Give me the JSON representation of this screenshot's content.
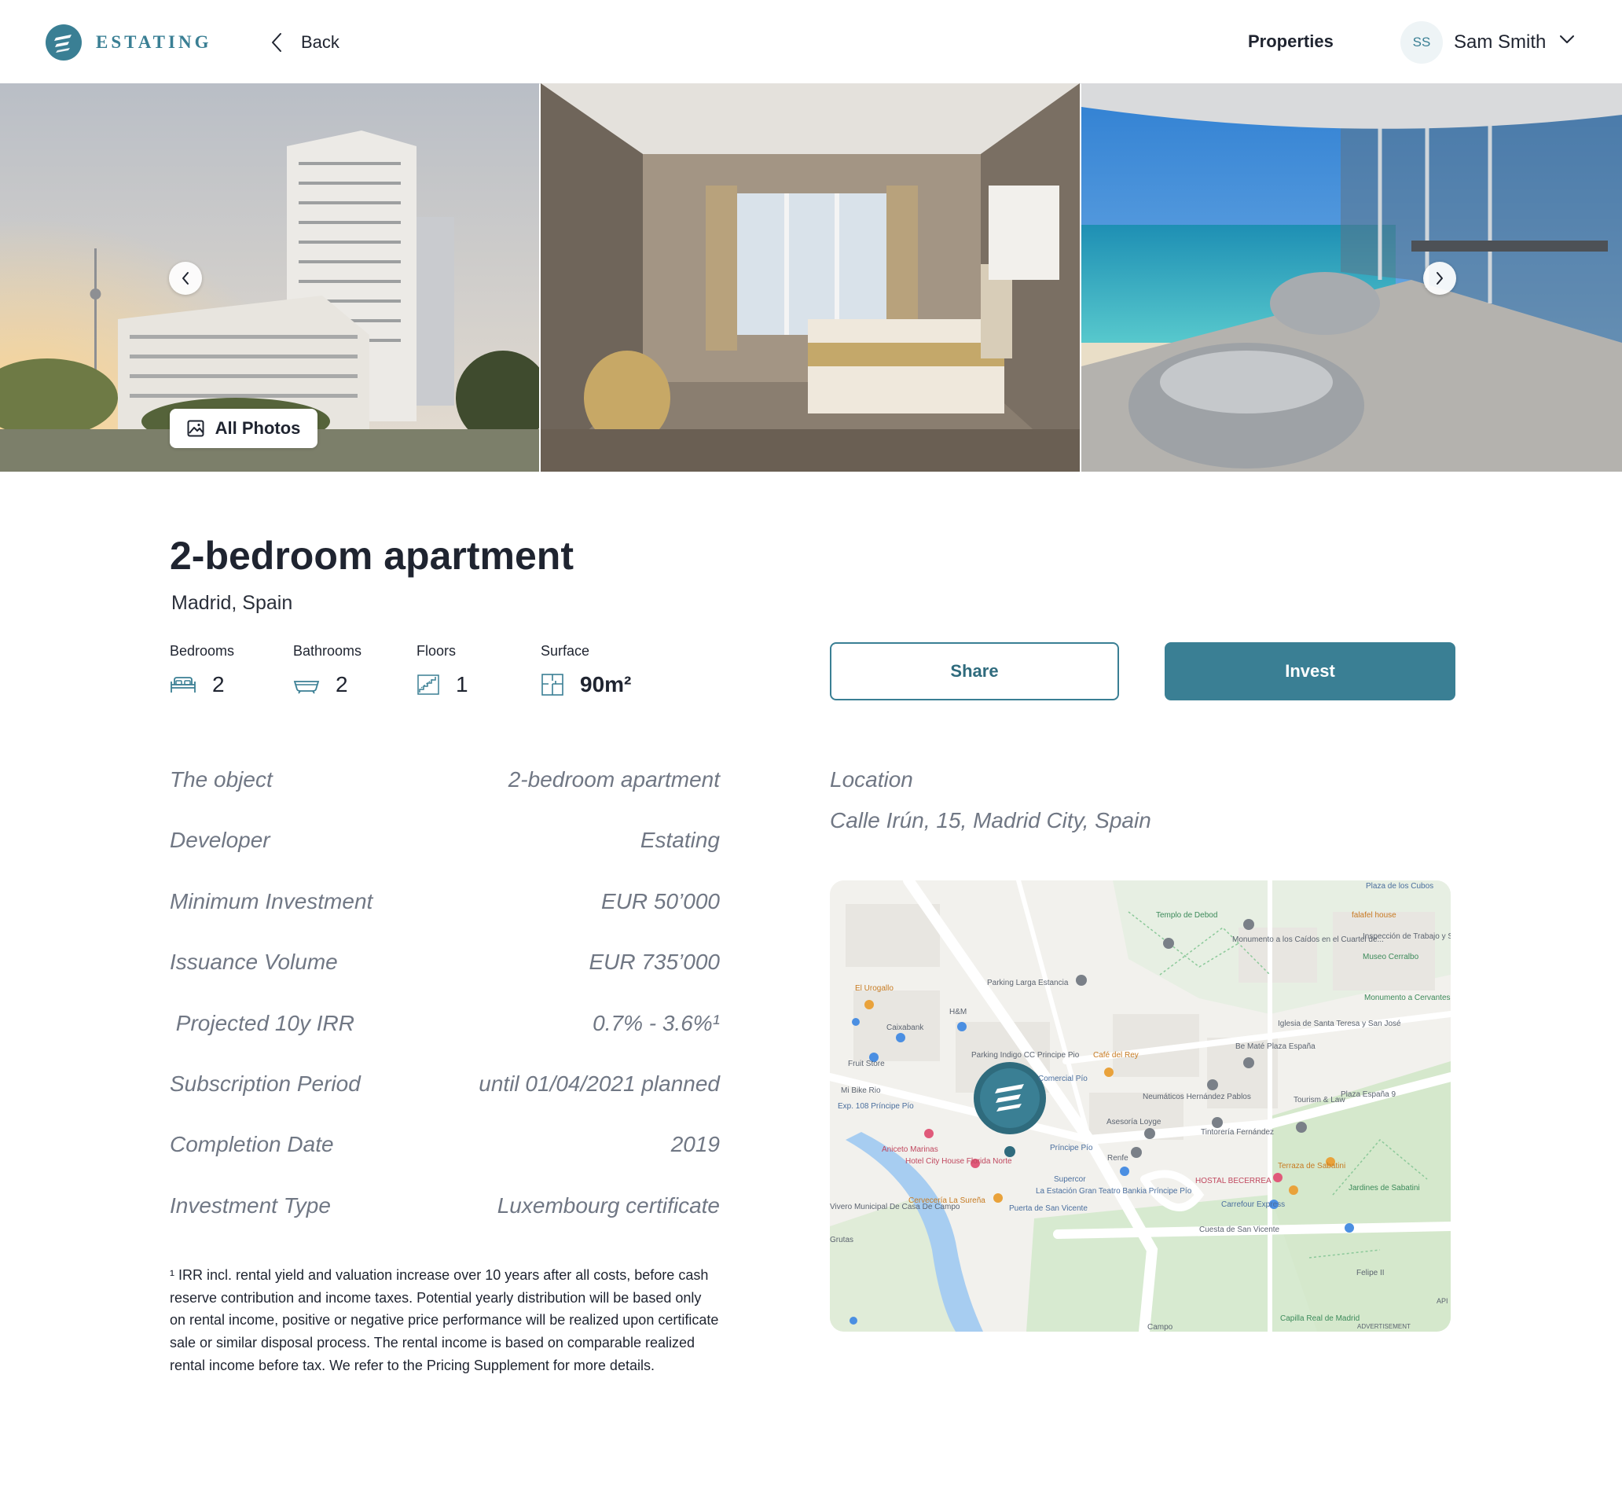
{
  "header": {
    "brand": "ESTATING",
    "back_label": "Back",
    "nav_properties": "Properties",
    "user_initials": "SS",
    "user_name": "Sam Smith"
  },
  "gallery": {
    "all_photos_label": "All Photos"
  },
  "property": {
    "title": "2-bedroom apartment",
    "location": "Madrid, Spain"
  },
  "stats": [
    {
      "label": "Bedrooms",
      "value": "2",
      "icon": "bed-icon"
    },
    {
      "label": "Bathrooms",
      "value": "2",
      "icon": "bathtub-icon"
    },
    {
      "label": "Floors",
      "value": "1",
      "icon": "stairs-icon"
    },
    {
      "label": "Surface",
      "value": "90m²",
      "icon": "floorplan-icon"
    }
  ],
  "actions": {
    "share_label": "Share",
    "invest_label": "Invest"
  },
  "details": [
    {
      "label": "The object",
      "value": "2-bedroom apartment"
    },
    {
      "label": "Developer",
      "value": "Estating"
    },
    {
      "label": "Minimum Investment",
      "value": "EUR 50’000"
    },
    {
      "label": "Issuance Volume",
      "value": "EUR 735’000"
    },
    {
      "label": " Projected 10y IRR",
      "value": "0.7% - 3.6%¹"
    },
    {
      "label": "Subscription Period",
      "value": "until 01/04/2021 planned"
    },
    {
      "label": "Completion Date",
      "value": "2019"
    },
    {
      "label": "Investment Type",
      "value": "Luxembourg certificate"
    }
  ],
  "footnote": "¹ IRR incl. rental yield and valuation increase over 10 years after all costs, before cash reserve contribution and income taxes. Potential yearly distribution will be based only on rental income, positive or negative price performance will be realized upon certificate sale or similar disposal process. The rental income is based on comparable realized rental income before tax. We refer to the Pricing Supplement for more details.",
  "location": {
    "label": "Location",
    "address": "Calle Irún, 15, Madrid City, Spain"
  },
  "map": {
    "labels": {
      "plaza_cubos": "Plaza de los Cubos",
      "templo": "Templo de Debod",
      "monumento": "Monumento a los Caídos en el Cuartel de...",
      "falafel": "falafel house",
      "inspeccion": "Inspección de Trabajo y Seguridad Social",
      "museo": "Museo Cerralbo",
      "parking_larga": "Parking Larga Estancia",
      "monumento_cervantes": "Monumento a Cervantes",
      "urogallo": "El Urogallo",
      "hm": "H&M",
      "caixabank": "Caixabank",
      "iglesia": "Iglesia de Santa Teresa y San José",
      "fruit_store": "Fruit Store",
      "parking_indigo": "Parking Indigo CC Principe Pio",
      "cafe_rey": "Café del Rey",
      "be_mate": "Be Maté Plaza España",
      "mi_bike": "Mi Bike Rio",
      "exp108": "Exp. 108 Príncipe Pío",
      "comercial": "Comercial Pío",
      "neumaticos": "Neumáticos Hernández Pablos",
      "tourism": "Tourism & Law",
      "plaza_espana9": "Plaza España 9",
      "asesoria": "Asesoría Loyge",
      "tintoreria": "Tintorería Fernández",
      "aniceto": "Aniceto Marinas",
      "hotel_city": "Hotel City House Florida Norte",
      "principe_pio": "Príncipe Pío",
      "renfe": "Renfe",
      "terraza": "Terraza de Sabatini",
      "supercor": "Supercor",
      "estacion": "La Estación Gran Teatro Bankia Príncipe Pío",
      "hostal": "HOSTAL BECERREA",
      "jardines": "Jardines de Sabatini",
      "cerveceria": "Cervecería La Sureña",
      "puerta": "Puerta de San Vicente",
      "carrefour": "Carrefour Express",
      "vivero": "Vivero Municipal De Casa De Campo",
      "cuesta": "Cuesta de San Vicente",
      "grutas": "Grutas",
      "felipe": "Felipe II",
      "capilla": "Capilla Real de Madrid",
      "campo": "Campo",
      "advertisement": "ADVERTISEMENT",
      "api": "API"
    }
  },
  "colors": {
    "brand": "#3a7f94",
    "text_primary": "#1f2430",
    "text_muted": "#707784"
  }
}
